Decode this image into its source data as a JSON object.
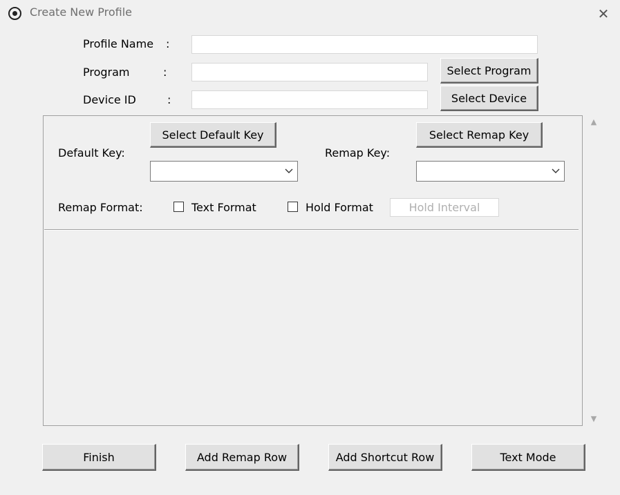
{
  "window": {
    "title": "Create New Profile",
    "close_symbol": "✕",
    "icon": "circle-dot-icon"
  },
  "form": {
    "profile_name": {
      "label": "Profile Name",
      "colon": ":",
      "value": ""
    },
    "program": {
      "label": "Program",
      "colon": ":",
      "value": "",
      "button": "Select Program"
    },
    "device_id": {
      "label": "Device ID",
      "colon": ":",
      "value": "",
      "button": "Select Device"
    }
  },
  "remap_panel": {
    "default_key_label": "Default Key:",
    "select_default_key": "Select Default Key",
    "default_key_value": "",
    "remap_key_label": "Remap Key:",
    "select_remap_key": "Select Remap Key",
    "remap_key_value": "",
    "remap_format_label": "Remap Format:",
    "text_format_label": "Text Format",
    "text_format_checked": false,
    "hold_format_label": "Hold Format",
    "hold_format_checked": false,
    "hold_interval_placeholder": "Hold Interval"
  },
  "scrollbar": {
    "up": "▲",
    "down": "▼"
  },
  "footer": {
    "finish": "Finish",
    "add_remap_row": "Add Remap Row",
    "add_shortcut_row": "Add Shortcut Row",
    "text_mode": "Text Mode"
  },
  "colors": {
    "background": "#f0f0f0",
    "button_face": "#e1e1e1",
    "title_text": "#6f6f6f"
  }
}
